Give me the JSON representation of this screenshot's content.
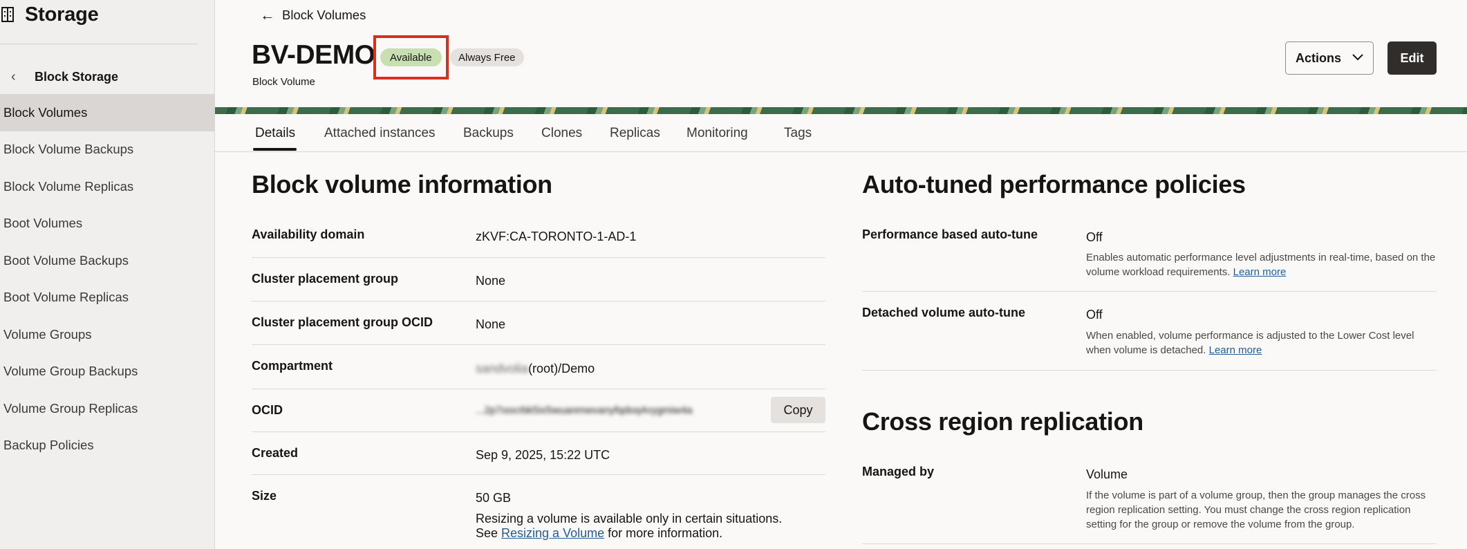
{
  "sidebar": {
    "title": "Storage",
    "back_label": "Block Storage",
    "items": [
      {
        "label": "Block Volumes"
      },
      {
        "label": "Block Volume Backups"
      },
      {
        "label": "Block Volume Replicas"
      },
      {
        "label": "Boot Volumes"
      },
      {
        "label": "Boot Volume Backups"
      },
      {
        "label": "Boot Volume Replicas"
      },
      {
        "label": "Volume Groups"
      },
      {
        "label": "Volume Group Backups"
      },
      {
        "label": "Volume Group Replicas"
      },
      {
        "label": "Backup Policies"
      }
    ]
  },
  "header": {
    "back_link": "Block Volumes",
    "title": "BV-DEMO",
    "status_badge": "Available",
    "tier_badge": "Always Free",
    "subtitle": "Block Volume",
    "actions_label": "Actions",
    "edit_label": "Edit"
  },
  "tabs": [
    {
      "label": "Details"
    },
    {
      "label": "Attached instances"
    },
    {
      "label": "Backups"
    },
    {
      "label": "Clones"
    },
    {
      "label": "Replicas"
    },
    {
      "label": "Monitoring"
    },
    {
      "label": "Tags"
    }
  ],
  "block_info": {
    "title": "Block volume information",
    "rows": [
      {
        "key": "Availability domain",
        "value": "zKVF:CA-TORONTO-1-AD-1"
      },
      {
        "key": "Cluster placement group",
        "value": "None"
      },
      {
        "key": "Cluster placement group OCID",
        "value": "None"
      },
      {
        "key": "Compartment",
        "value_blurred": "sandvolia",
        "value": "(root)/Demo"
      },
      {
        "key": "OCID",
        "value": "...2p7oocrbk5ix5wuanmwvanyfqdoq4vygmiw4a",
        "copy_label": "Copy"
      },
      {
        "key": "Created",
        "value": "Sep 9, 2025, 15:22 UTC"
      },
      {
        "key": "Size",
        "value": "50 GB",
        "note_1": "Resizing a volume is available only in certain situations.",
        "note_2_pre": "See ",
        "note_2_link": "Resizing a Volume",
        "note_2_post": " for more information."
      }
    ]
  },
  "auto_tune": {
    "title": "Auto-tuned performance policies",
    "rows": [
      {
        "key": "Performance based auto-tune",
        "value": "Off",
        "desc": "Enables automatic performance level adjustments in real-time, based on the volume workload requirements.",
        "link": "Learn more"
      },
      {
        "key": "Detached volume auto-tune",
        "value": "Off",
        "desc": "When enabled, volume performance is adjusted to the Lower Cost level when volume is detached.",
        "link": "Learn more"
      }
    ]
  },
  "replication": {
    "title": "Cross region replication",
    "rows": [
      {
        "key": "Managed by",
        "value": "Volume",
        "desc": "If the volume is part of a volume group, then the group manages the cross region replication setting. You must change the cross region replication setting for the group or remove the volume from the group."
      }
    ]
  },
  "colors": {
    "status_badge_bg": "#c8dfb1",
    "highlight": "#d7311e",
    "edit_button_bg": "#312d2a",
    "link": "#1f5c99"
  }
}
